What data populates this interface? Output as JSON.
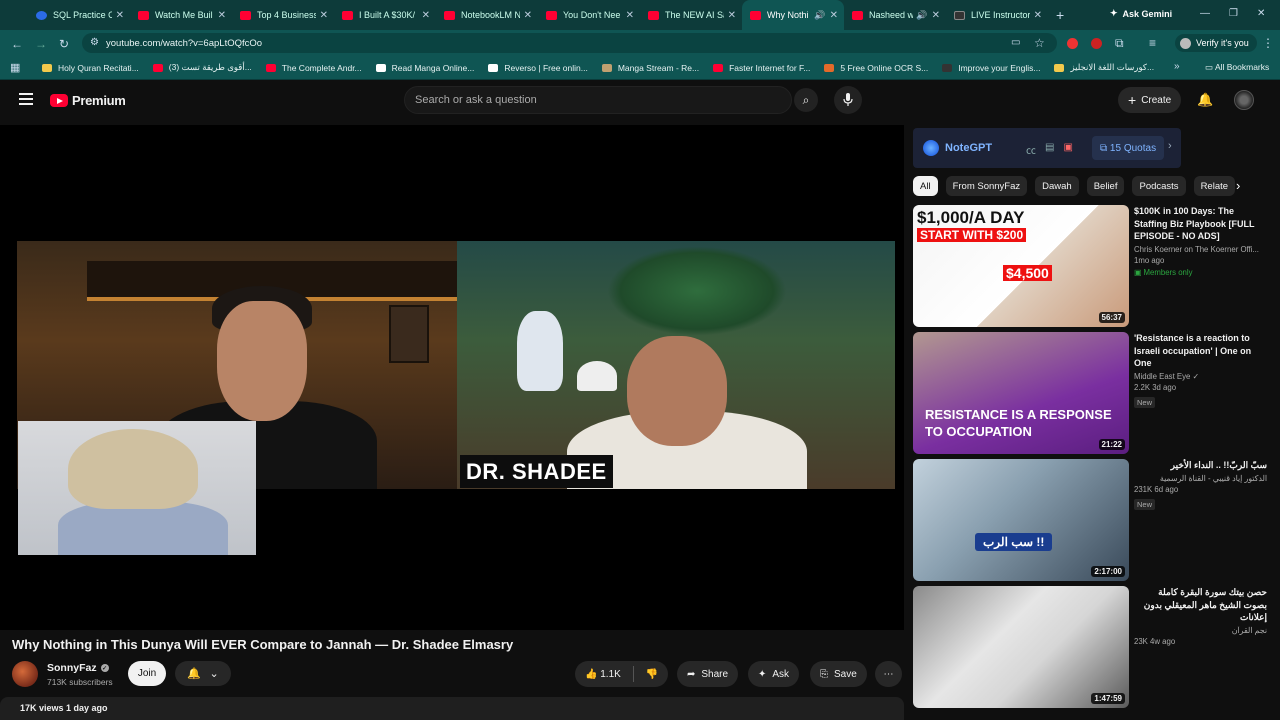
{
  "browser": {
    "tabs": [
      {
        "title": "SQL Practice O",
        "favicon": "blue"
      },
      {
        "title": "Watch Me Buil",
        "favicon": "red"
      },
      {
        "title": "Top 4 Business",
        "favicon": "red"
      },
      {
        "title": "I Built A $30K/",
        "favicon": "red"
      },
      {
        "title": "NotebookLM N",
        "favicon": "red"
      },
      {
        "title": "You Don't Nee",
        "favicon": "red"
      },
      {
        "title": "The NEW AI Sa",
        "favicon": "red"
      },
      {
        "title": "Why Nothi",
        "favicon": "red",
        "active": true
      },
      {
        "title": "Nasheed w",
        "favicon": "red"
      },
      {
        "title": "LIVE Instructor",
        "favicon": "dark"
      }
    ],
    "ask_gemini": "Ask Gemini",
    "url": "youtube.com/watch?v=6apLtOQfcOo",
    "verify_label": "Verify it's you",
    "bookmarks": [
      {
        "label": "Holy Quran Recitati...",
        "icon_color": "#f2c94c"
      },
      {
        "label": "(3) أقوى طريقة تست...",
        "icon_color": "#ff0033"
      },
      {
        "label": "The Complete Andr...",
        "icon_color": "#ff0033"
      },
      {
        "label": "Read Manga Online...",
        "icon_color": "#ffffff"
      },
      {
        "label": "Reverso | Free onlin...",
        "icon_color": "#ffffff"
      },
      {
        "label": "Manga Stream - Re...",
        "icon_color": "#c0a070"
      },
      {
        "label": "Faster Internet for F...",
        "icon_color": "#ff0033"
      },
      {
        "label": "5 Free Online OCR S...",
        "icon_color": "#e36a2a"
      },
      {
        "label": "Improve your Englis...",
        "icon_color": "#333333"
      },
      {
        "label": "كورسات اللغة الانجليز...",
        "icon_color": "#f2c94c"
      }
    ],
    "all_bookmarks": "All Bookmarks"
  },
  "youtube": {
    "logo_text": "Premium",
    "search_placeholder": "Search or ask a question",
    "create_label": "Create"
  },
  "video": {
    "overlay_name": "DR. SHADEE",
    "title": "Why Nothing in This Dunya Will EVER Compare to Jannah — Dr. Shadee Elmasry",
    "channel": "SonnyFaz",
    "subscribers": "713K subscribers",
    "join_label": "Join",
    "likes": "1.1K",
    "share_label": "Share",
    "ask_label": "Ask",
    "save_label": "Save",
    "views_date": "17K views  1 day ago"
  },
  "notegpt": {
    "name": "NoteGPT",
    "quota": "15 Quotas"
  },
  "chips": [
    "All",
    "From SonnyFaz",
    "Dawah",
    "Belief",
    "Podcasts",
    "Relate"
  ],
  "recommendations": [
    {
      "title": "$100K in 100 Days: The Staffing Biz Playbook [FULL EPISODE - NO ADS]",
      "channel": "Chris Koerner on The Koerner Offi...",
      "meta": "1mo ago",
      "members": "Members only",
      "duration": "56:37",
      "thumb_text_1": "$1,000/A DAY",
      "thumb_text_2": "START WITH $200",
      "thumb_text_3": "$4,500"
    },
    {
      "title": "'Resistance is a reaction to Israeli occupation' | One on One",
      "channel": "Middle East Eye",
      "meta": "2.2K  3d ago",
      "badge": "New",
      "duration": "21:22",
      "thumb_text_1": "RESISTANCE IS A RESPONSE TO OCCUPATION"
    },
    {
      "title": "سبّ الربّ!! .. النداء الأخير",
      "channel": "الدكتور إياد قنيبي - القناة الرسمية",
      "meta": "231K  6d ago",
      "badge": "New",
      "duration": "2:17:00",
      "thumb_text_1": "سب الرب !!"
    },
    {
      "title": "حصن بيتك سورة البقرة كاملة بصوت الشيخ ماهر المعيقلي بدون إعلانات",
      "channel": "نجم القرآن",
      "meta": "23K  4w ago",
      "duration": "1:47:59"
    }
  ]
}
